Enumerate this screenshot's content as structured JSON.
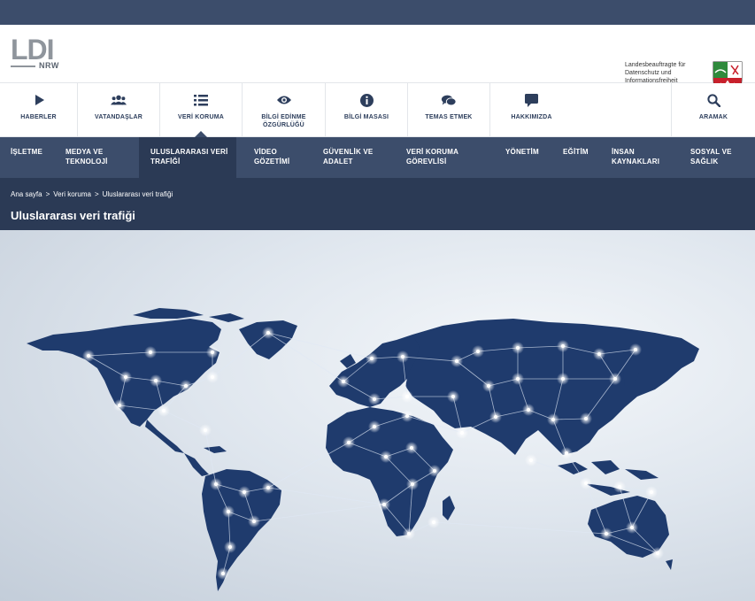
{
  "header": {
    "logo_text": "LDI",
    "logo_sub": "NRW",
    "authority_line1": "Landesbeauftragte für",
    "authority_line2": "Datenschutz und",
    "authority_line3": "Informationsfreiheit"
  },
  "main_nav": [
    {
      "label": "HABERLER",
      "icon": "play-icon"
    },
    {
      "label": "VATANDAŞLAR",
      "icon": "users-icon"
    },
    {
      "label": "VERİ KORUMA",
      "icon": "list-icon"
    },
    {
      "label": "BİLGİ EDİNME ÖZGÜRLÜĞÜ",
      "icon": "eye-icon"
    },
    {
      "label": "BİLGİ MASASI",
      "icon": "info-icon"
    },
    {
      "label": "TEMAS ETMEK",
      "icon": "chat-icon"
    },
    {
      "label": "HAKKIMIZDA",
      "icon": "comment-icon"
    },
    {
      "label": "ARAMAK",
      "icon": "search-icon"
    }
  ],
  "sub_nav": [
    {
      "label": "İŞLETME"
    },
    {
      "label": "MEDYA VE TEKNOLOJİ"
    },
    {
      "label": "ULUSLARARASI VERİ TRAFİĞİ"
    },
    {
      "label": "VİDEO GÖZETİMİ"
    },
    {
      "label": "GÜVENLİK VE ADALET"
    },
    {
      "label": "VERİ KORUMA GÖREVLİSİ"
    },
    {
      "label": "YÖNETİM"
    },
    {
      "label": "EĞİTİM"
    },
    {
      "label": "İNSAN KAYNAKLARI"
    },
    {
      "label": "SOSYAL VE SAĞLIK"
    }
  ],
  "breadcrumb": [
    "Ana sayfa",
    ">",
    "Veri koruma",
    ">",
    "Uluslararası veri trafiği"
  ],
  "page_title": "Uluslararası veri trafiği",
  "colors": {
    "topbar": "#3c4d6b",
    "titlebar": "#2b3a55",
    "map": "#1f3b6d",
    "accent": "#2d3e5c"
  }
}
